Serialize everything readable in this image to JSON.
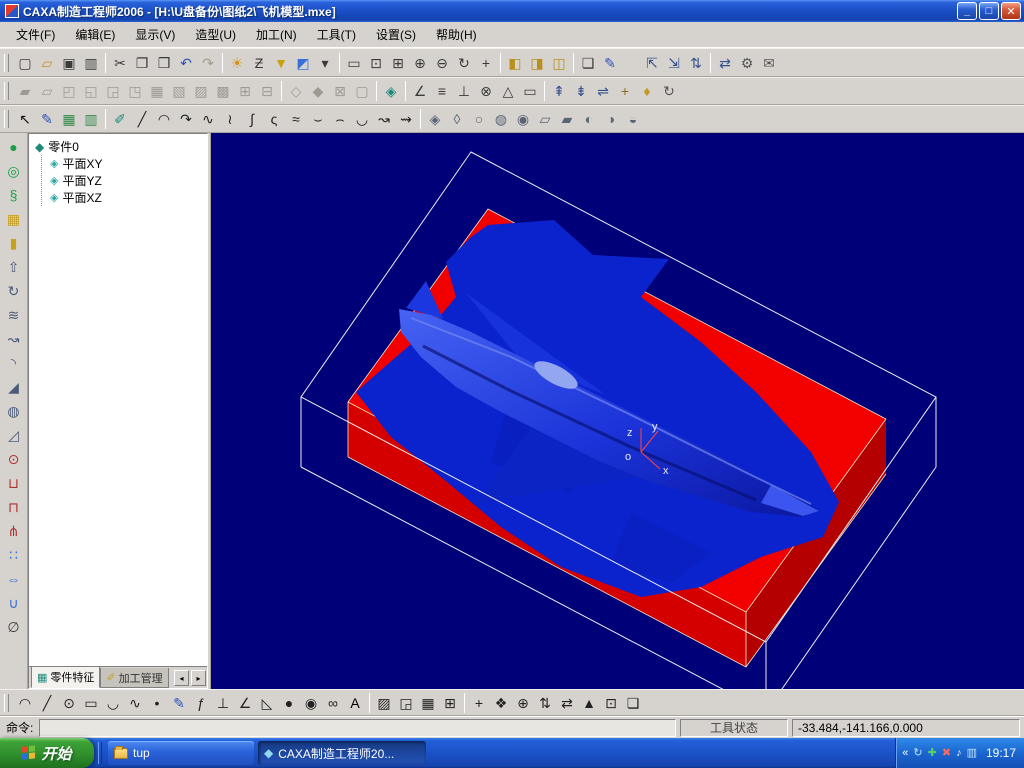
{
  "window": {
    "title": "CAXA制造工程师2006  -  [H:\\U盘备份\\图纸2\\飞机模型.mxe]",
    "min_glyph": "_",
    "restore_glyph": "□",
    "close_glyph": "✕"
  },
  "menu": {
    "items": [
      {
        "label": "文件(F)"
      },
      {
        "label": "编辑(E)"
      },
      {
        "label": "显示(V)"
      },
      {
        "label": "造型(U)"
      },
      {
        "label": "加工(N)"
      },
      {
        "label": "工具(T)"
      },
      {
        "label": "设置(S)"
      },
      {
        "label": "帮助(H)"
      }
    ]
  },
  "toolbars": {
    "row1": [
      {
        "name": "new-file-icon",
        "glyph": "▢"
      },
      {
        "name": "open-file-icon",
        "glyph": "▱",
        "color": "#c89020"
      },
      {
        "name": "save-icon",
        "glyph": "▣"
      },
      {
        "name": "print-icon",
        "glyph": "▥"
      },
      {
        "sep": true
      },
      {
        "name": "cut-icon",
        "glyph": "✂"
      },
      {
        "name": "copy-icon",
        "glyph": "❐"
      },
      {
        "name": "paste-icon",
        "glyph": "❒"
      },
      {
        "name": "undo-icon",
        "glyph": "↶",
        "color": "#2a52b8"
      },
      {
        "name": "redo-icon",
        "glyph": "↷",
        "disabled": true
      },
      {
        "sep": true
      },
      {
        "name": "light-icon",
        "glyph": "☀",
        "color": "#d89010"
      },
      {
        "name": "shade-mode-icon",
        "glyph": "Ƶ"
      },
      {
        "name": "pick-filter-icon",
        "glyph": "▼",
        "color": "#c8a010"
      },
      {
        "name": "color-picker-icon",
        "glyph": "◩",
        "color": "#3a6fd8"
      },
      {
        "name": "color-dropdown-icon",
        "glyph": "▾"
      },
      {
        "sep": true
      },
      {
        "name": "redraw-icon",
        "glyph": "▭"
      },
      {
        "name": "zoom-all-icon",
        "glyph": "⊡"
      },
      {
        "name": "zoom-window-icon",
        "glyph": "⊞"
      },
      {
        "name": "zoom-in-icon",
        "glyph": "⊕"
      },
      {
        "name": "zoom-out-icon",
        "glyph": "⊖"
      },
      {
        "name": "rotate-view-icon",
        "glyph": "↻"
      },
      {
        "name": "pan-view-icon",
        "glyph": "+"
      },
      {
        "sep": true
      },
      {
        "name": "view-front-icon",
        "glyph": "◧",
        "color": "#b8901a"
      },
      {
        "name": "view-side-icon",
        "glyph": "◨",
        "color": "#b8901a"
      },
      {
        "name": "view-axono-icon",
        "glyph": "◫",
        "color": "#b8901a"
      },
      {
        "sep": true
      },
      {
        "name": "copy-view-icon",
        "glyph": "❏"
      },
      {
        "name": "annotate-pen-icon",
        "glyph": "✎",
        "color": "#2a52b8"
      },
      {
        "gap": true
      },
      {
        "name": "toolpath-x-icon",
        "glyph": "⇱",
        "color": "#33508e"
      },
      {
        "name": "toolpath-y-icon",
        "glyph": "⇲",
        "color": "#33508e"
      },
      {
        "name": "toolpath-z-icon",
        "glyph": "⇅",
        "color": "#33508e"
      },
      {
        "sep": true
      },
      {
        "name": "trajectory-sim-icon",
        "glyph": "⇄",
        "color": "#33508e"
      },
      {
        "name": "post-process-icon",
        "glyph": "⚙",
        "color": "#555555"
      },
      {
        "name": "gcode-icon",
        "glyph": "✉",
        "color": "#555555"
      }
    ],
    "row2": [
      {
        "name": "sketch-new-icon",
        "glyph": "▰",
        "disabled": true
      },
      {
        "name": "sketch-edit-icon",
        "glyph": "▱",
        "disabled": true
      },
      {
        "name": "sketch-exit-icon",
        "glyph": "◰",
        "disabled": true
      },
      {
        "name": "dimension-icon",
        "glyph": "◱",
        "disabled": true
      },
      {
        "name": "constraint-icon",
        "glyph": "◲",
        "disabled": true
      },
      {
        "name": "trim-icon",
        "glyph": "◳",
        "disabled": true
      },
      {
        "name": "extend-icon",
        "glyph": "▦",
        "disabled": true
      },
      {
        "name": "offset-curve-icon",
        "glyph": "▧",
        "disabled": true
      },
      {
        "name": "mirror-curve-icon",
        "glyph": "▨",
        "disabled": true
      },
      {
        "name": "array-curve-icon",
        "glyph": "▩",
        "disabled": true
      },
      {
        "name": "fillet-curve-icon",
        "glyph": "⊞",
        "disabled": true
      },
      {
        "name": "chamfer-curve-icon",
        "glyph": "⊟",
        "disabled": true
      },
      {
        "sep": true
      },
      {
        "name": "equidistant-icon",
        "glyph": "◇",
        "disabled": true
      },
      {
        "name": "bridge-icon",
        "glyph": "◆",
        "disabled": true
      },
      {
        "name": "break-icon",
        "glyph": "⊠",
        "disabled": true
      },
      {
        "name": "combine-icon",
        "glyph": "▢",
        "disabled": true
      },
      {
        "sep": true
      },
      {
        "name": "render-mode-icon",
        "glyph": "◈",
        "color": "#1f8a7a"
      },
      {
        "sep": true
      },
      {
        "name": "angle-icon",
        "glyph": "∠"
      },
      {
        "name": "parallel-icon",
        "glyph": "≡"
      },
      {
        "name": "perpendicular-icon",
        "glyph": "⊥"
      },
      {
        "name": "tangent-icon",
        "glyph": "⊗"
      },
      {
        "name": "triangle-icon",
        "glyph": "△"
      },
      {
        "name": "rect-tool-icon",
        "glyph": "▭"
      },
      {
        "sep": true
      },
      {
        "name": "level-up-icon",
        "glyph": "⇞",
        "color": "#33508e"
      },
      {
        "name": "level-down-icon",
        "glyph": "⇟",
        "color": "#33508e"
      },
      {
        "name": "swap-icon",
        "glyph": "⇌",
        "color": "#33508e"
      },
      {
        "name": "anchor-icon",
        "glyph": "+",
        "color": "#8a6d1a"
      },
      {
        "name": "gem-icon",
        "glyph": "♦",
        "color": "#c09a20"
      },
      {
        "name": "refresh-alt-icon",
        "glyph": "↻",
        "color": "#555555"
      }
    ],
    "row3": [
      {
        "name": "select-arrow-icon",
        "glyph": "↖",
        "color": "#111111"
      },
      {
        "name": "sketch-pencil-icon",
        "glyph": "✎",
        "color": "#2a52b8"
      },
      {
        "name": "profile-grid-icon",
        "glyph": "▦",
        "color": "#2f8a4a"
      },
      {
        "name": "profile-grid2-icon",
        "glyph": "▥",
        "color": "#2f8a4a"
      },
      {
        "sep": true
      },
      {
        "name": "erase-icon",
        "glyph": "✐",
        "color": "#1f8a7a"
      },
      {
        "name": "line-icon",
        "glyph": "╱",
        "color": "#222222"
      },
      {
        "name": "arc-icon",
        "glyph": "◠",
        "color": "#222222"
      },
      {
        "name": "arc-3pt-icon",
        "glyph": "↷",
        "color": "#222222"
      },
      {
        "name": "spline-icon",
        "glyph": "∿",
        "color": "#222222"
      },
      {
        "name": "wave-curve-icon",
        "glyph": "≀",
        "color": "#222222"
      },
      {
        "name": "integral-curve-icon",
        "glyph": "∫",
        "color": "#222222"
      },
      {
        "name": "s-curve-icon",
        "glyph": "ς",
        "color": "#222222"
      },
      {
        "name": "approx-curve-icon",
        "glyph": "≈",
        "color": "#222222"
      },
      {
        "name": "arc-up-icon",
        "glyph": "⌣",
        "color": "#222222"
      },
      {
        "name": "arc-down-icon",
        "glyph": "⌢",
        "color": "#222222"
      },
      {
        "name": "half-arc-icon",
        "glyph": "◡",
        "color": "#222222"
      },
      {
        "name": "squiggle-icon",
        "glyph": "↝",
        "color": "#222222"
      },
      {
        "name": "squiggle2-icon",
        "glyph": "⇝",
        "color": "#222222"
      },
      {
        "sep": true
      },
      {
        "name": "ruled-surface-icon",
        "glyph": "◈",
        "color": "#5a6478"
      },
      {
        "name": "revolve-surface-icon",
        "glyph": "◊",
        "color": "#5a6478"
      },
      {
        "name": "sweep-surface-icon",
        "glyph": "○",
        "color": "#5a6478"
      },
      {
        "name": "mesh-surface-icon",
        "glyph": "◍",
        "color": "#5a6478"
      },
      {
        "name": "offset-surface-icon",
        "glyph": "◉",
        "color": "#5a6478"
      },
      {
        "name": "trim-surface-icon",
        "glyph": "▱",
        "color": "#5a6478"
      },
      {
        "name": "extend-surface-icon",
        "glyph": "▰",
        "color": "#5a6478"
      },
      {
        "name": "blend-surface-icon",
        "glyph": "◐",
        "color": "#5a6478"
      },
      {
        "name": "patch-surface-icon",
        "glyph": "◑",
        "color": "#5a6478"
      },
      {
        "name": "stitch-surface-icon",
        "glyph": "◒",
        "color": "#5a6478"
      }
    ],
    "left": [
      {
        "name": "sphere-feature-icon",
        "glyph": "●",
        "color": "#18a048"
      },
      {
        "name": "torus-feature-icon",
        "glyph": "◎",
        "color": "#18a048"
      },
      {
        "name": "helix-feature-icon",
        "glyph": "§",
        "color": "#18a048"
      },
      {
        "name": "mesh-feature-icon",
        "glyph": "▦",
        "color": "#c8a020"
      },
      {
        "name": "block-feature-icon",
        "glyph": "▮",
        "color": "#c8a020"
      },
      {
        "name": "extrude-icon",
        "glyph": "⇧",
        "color": "#4a5a7a"
      },
      {
        "name": "revolve-icon",
        "glyph": "↻",
        "color": "#4a5a7a"
      },
      {
        "name": "loft-icon",
        "glyph": "≋",
        "color": "#4a5a7a"
      },
      {
        "name": "sweep-icon",
        "glyph": "↝",
        "color": "#4a5a7a"
      },
      {
        "name": "fillet-icon",
        "glyph": "◝",
        "color": "#4a5a7a"
      },
      {
        "name": "chamfer-icon",
        "glyph": "◢",
        "color": "#4a5a7a"
      },
      {
        "name": "shell-icon",
        "glyph": "◍",
        "color": "#4a5a7a"
      },
      {
        "name": "draft-icon",
        "glyph": "◿",
        "color": "#4a5a7a"
      },
      {
        "name": "hole-icon",
        "glyph": "⊙",
        "color": "#b03030"
      },
      {
        "name": "pocket-icon",
        "glyph": "⊔",
        "color": "#b03030"
      },
      {
        "name": "boss-icon",
        "glyph": "⊓",
        "color": "#b03030"
      },
      {
        "name": "rib-icon",
        "glyph": "⋔",
        "color": "#b03030"
      },
      {
        "name": "pattern-icon",
        "glyph": "∷",
        "color": "#3a6fd8"
      },
      {
        "name": "mirror-icon",
        "glyph": "⇔",
        "color": "#3a6fd8"
      },
      {
        "name": "boolean-icon",
        "glyph": "∪",
        "color": "#3a6fd8"
      },
      {
        "name": "measure-icon",
        "glyph": "∅"
      }
    ],
    "bottom": [
      {
        "name": "arc-draw-icon",
        "glyph": "◠",
        "color": "#222222"
      },
      {
        "name": "line-draw-icon",
        "glyph": "╱",
        "color": "#222222"
      },
      {
        "name": "circle-draw-icon",
        "glyph": "⊙",
        "color": "#222222"
      },
      {
        "name": "rect-draw-icon",
        "glyph": "▭",
        "color": "#222222"
      },
      {
        "name": "ellipse-draw-icon",
        "glyph": "◡",
        "color": "#222222"
      },
      {
        "name": "spline-draw-icon",
        "glyph": "∿",
        "color": "#222222"
      },
      {
        "name": "point-draw-icon",
        "glyph": "•",
        "color": "#222222"
      },
      {
        "name": "pencil-draw-icon",
        "glyph": "✎",
        "color": "#2a52b8"
      },
      {
        "name": "formula-icon",
        "glyph": "ƒ",
        "color": "#222222"
      },
      {
        "name": "perpendicular-draw-icon",
        "glyph": "⊥",
        "color": "#222222"
      },
      {
        "name": "angle-draw-icon",
        "glyph": "∠",
        "color": "#222222"
      },
      {
        "name": "triangle-draw-icon",
        "glyph": "◺",
        "color": "#222222"
      },
      {
        "name": "filled-circle-icon",
        "glyph": "●",
        "color": "#222222"
      },
      {
        "name": "concentric-icon",
        "glyph": "◉",
        "color": "#222222"
      },
      {
        "name": "infinity-icon",
        "glyph": "∞",
        "color": "#222222"
      },
      {
        "name": "text-tool-icon",
        "glyph": "A",
        "color": "#000000"
      },
      {
        "sep": true
      },
      {
        "name": "hatch-icon",
        "glyph": "▨",
        "color": "#222222"
      },
      {
        "name": "region-icon",
        "glyph": "◲",
        "color": "#222222"
      },
      {
        "name": "grid-tool-icon",
        "glyph": "▦",
        "color": "#222222"
      },
      {
        "name": "table-tool-icon",
        "glyph": "⊞",
        "color": "#222222"
      },
      {
        "sep": true
      },
      {
        "name": "move-icon",
        "glyph": "+",
        "color": "#222222"
      },
      {
        "name": "array-4way-icon",
        "glyph": "❖",
        "color": "#222222"
      },
      {
        "name": "center-mark-icon",
        "glyph": "⊕",
        "color": "#222222"
      },
      {
        "name": "flip-v-icon",
        "glyph": "⇅",
        "color": "#222222"
      },
      {
        "name": "flip-h-icon",
        "glyph": "⇄",
        "color": "#222222"
      },
      {
        "name": "mirror-v-icon",
        "glyph": "▲",
        "color": "#222222"
      },
      {
        "name": "array-grid-icon",
        "glyph": "⊡",
        "color": "#222222"
      },
      {
        "name": "clone-icon",
        "glyph": "❏",
        "color": "#222222"
      }
    ]
  },
  "tree": {
    "root": "零件0",
    "children": [
      "平面XY",
      "平面YZ",
      "平面XZ"
    ]
  },
  "panel_tabs": {
    "part_tab": "零件特征",
    "machine_tab": "加工管理",
    "scroll_left": "◂",
    "scroll_right": "▸"
  },
  "scene": {
    "bg": "#000078",
    "stock_top": "#f20000",
    "stock_left": "#d40000",
    "stock_right": "#b40000",
    "surface": "#0b23cc",
    "wire": "#ededed",
    "edge": "#f2eec8",
    "axis": "#ff4444",
    "axis_labels": {
      "z": "z",
      "y": "y",
      "x": "x",
      "o": "o"
    }
  },
  "statusbar": {
    "command_label": "命令:",
    "tool_state_label": "工具状态",
    "coordinates": "-33.484,-141.166,0.000"
  },
  "taskbar": {
    "start_label": "开始",
    "tasks": [
      {
        "label": "tup"
      },
      {
        "label": "CAXA制造工程师20..."
      }
    ],
    "tray": {
      "chevron": "«",
      "icons": [
        {
          "name": "update-tray-icon",
          "glyph": "↻",
          "color": "#bfe3ff"
        },
        {
          "name": "safety-tray-icon",
          "glyph": "✚",
          "color": "#58d06a"
        },
        {
          "name": "alert-tray-icon",
          "glyph": "✖",
          "color": "#ff6a5a"
        },
        {
          "name": "volume-tray-icon",
          "glyph": "♪",
          "color": "#eaf4ff"
        },
        {
          "name": "network-tray-icon",
          "glyph": "▥",
          "color": "#bfe3ff"
        }
      ],
      "clock": "19:17"
    }
  }
}
